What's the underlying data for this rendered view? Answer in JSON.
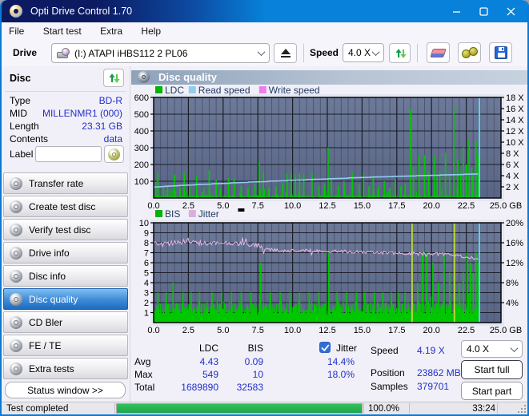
{
  "window": {
    "title": "Opti Drive Control 1.70"
  },
  "menu": {
    "items": [
      "File",
      "Start test",
      "Extra",
      "Help"
    ]
  },
  "toolbar": {
    "drive_label": "Drive",
    "drive_value": "(I:)   ATAPI iHBS112   2 PL06",
    "speed_label": "Speed",
    "speed_value": "4.0 X"
  },
  "sidebar": {
    "disc_header": "Disc",
    "info": [
      {
        "label": "Type",
        "value": "BD-R"
      },
      {
        "label": "MID",
        "value": "MILLENMR1 (000)"
      },
      {
        "label": "Length",
        "value": "23.31 GB"
      },
      {
        "label": "Contents",
        "value": "data"
      }
    ],
    "label_field": {
      "label": "Label",
      "value": ""
    },
    "buttons": [
      {
        "label": "Transfer rate",
        "selected": false
      },
      {
        "label": "Create test disc",
        "selected": false
      },
      {
        "label": "Verify test disc",
        "selected": false
      },
      {
        "label": "Drive info",
        "selected": false
      },
      {
        "label": "Disc info",
        "selected": false
      },
      {
        "label": "Disc quality",
        "selected": true
      },
      {
        "label": "CD Bler",
        "selected": false
      },
      {
        "label": "FE / TE",
        "selected": false
      },
      {
        "label": "Extra tests",
        "selected": false
      }
    ],
    "status_window_button": "Status window >>"
  },
  "main": {
    "header": "Disc quality"
  },
  "stats": {
    "col_ldc": "LDC",
    "col_bis": "BIS",
    "jitter_label": "Jitter",
    "jitter_checked": true,
    "rows": [
      {
        "label": "Avg",
        "ldc": "4.43",
        "bis": "0.09",
        "jitter": "14.4%"
      },
      {
        "label": "Max",
        "ldc": "549",
        "bis": "10",
        "jitter": "18.0%"
      },
      {
        "label": "Total",
        "ldc": "1689890",
        "bis": "32583",
        "jitter": ""
      }
    ],
    "speed_label": "Speed",
    "speed_value": "4.19 X",
    "position_label": "Position",
    "position_value": "23862 MB",
    "samples_label": "Samples",
    "samples_value": "379701",
    "speed_select": "4.0 X",
    "start_full": "Start full",
    "start_part": "Start part"
  },
  "statusbar": {
    "status": "Test completed",
    "percent": "100.0%",
    "percent_value": 100,
    "elapsed": "33:24"
  },
  "colors": {
    "titlebar_navy": "#0c1a61",
    "titlebar_azure": "#0781d9",
    "value_blue": "#2230c8",
    "plot_bg": "#616e8e",
    "ldc_green": "#00c800",
    "read_speed_blue": "#93cbf1",
    "write_speed_pink": "#ef7cf0",
    "jitter_pink": "#e3b9e6",
    "end_marker_cyan": "#59d3f7",
    "progress_green": "#22ac4d"
  },
  "chart_data": [
    {
      "type": "area",
      "title": "LDC / Read speed / Write speed vs position",
      "legend": [
        {
          "label": "LDC",
          "color": "#00b400"
        },
        {
          "label": "Read speed",
          "color": "#93cbf1"
        },
        {
          "label": "Write speed",
          "color": "#ef7cf0"
        }
      ],
      "legend_marker": false,
      "xlim": [
        0,
        25
      ],
      "x_ticks": [
        0.0,
        2.5,
        5.0,
        7.5,
        10.0,
        12.5,
        15.0,
        17.5,
        20.0,
        22.5,
        25.0
      ],
      "x_unit": "GB",
      "x_minor_step": 0.5,
      "left_axis": {
        "lim": [
          0,
          600
        ],
        "ticks": [
          100,
          200,
          300,
          400,
          500,
          600
        ],
        "suffix": ""
      },
      "right_axis": {
        "lim": [
          0,
          18
        ],
        "ticks": [
          2,
          4,
          6,
          8,
          10,
          12,
          14,
          16,
          18
        ],
        "suffix": " X"
      },
      "data_end_x": 23.42,
      "texture_seed": 11,
      "series": [
        {
          "name": "LDC",
          "kind": "spikes",
          "axis": "left",
          "color": "#00c800",
          "baseline": {
            "min": 3,
            "max": 18,
            "burst_chance": 0.09,
            "burst_extra": 50
          },
          "points": [
            [
              0.15,
              95
            ],
            [
              0.3,
              150
            ],
            [
              0.7,
              60
            ],
            [
              1.0,
              70
            ],
            [
              1.5,
              140
            ],
            [
              1.9,
              60
            ],
            [
              2.2,
              150
            ],
            [
              2.6,
              70
            ],
            [
              3.1,
              130
            ],
            [
              3.6,
              60
            ],
            [
              4.0,
              165
            ],
            [
              4.5,
              110
            ],
            [
              4.8,
              55
            ],
            [
              5.4,
              120
            ],
            [
              5.8,
              115
            ],
            [
              6.3,
              70
            ],
            [
              6.8,
              60
            ],
            [
              7.3,
              80
            ],
            [
              7.6,
              215
            ],
            [
              7.9,
              160
            ],
            [
              8.3,
              60
            ],
            [
              8.8,
              70
            ],
            [
              9.3,
              90
            ],
            [
              9.6,
              145
            ],
            [
              9.9,
              150
            ],
            [
              10.2,
              140
            ],
            [
              10.5,
              150
            ],
            [
              10.8,
              140
            ],
            [
              11.4,
              150
            ],
            [
              11.9,
              70
            ],
            [
              12.3,
              80
            ],
            [
              12.55,
              300
            ],
            [
              12.8,
              120
            ],
            [
              13.3,
              70
            ],
            [
              13.7,
              100
            ],
            [
              14.3,
              150
            ],
            [
              14.8,
              80
            ],
            [
              15.1,
              150
            ],
            [
              15.5,
              70
            ],
            [
              15.8,
              130
            ],
            [
              16.2,
              70
            ],
            [
              16.6,
              100
            ],
            [
              17.0,
              60
            ],
            [
              17.4,
              110
            ],
            [
              17.8,
              70
            ],
            [
              18.1,
              90
            ],
            [
              18.5,
              530
            ],
            [
              18.7,
              180
            ],
            [
              19.1,
              260
            ],
            [
              19.5,
              255
            ],
            [
              19.8,
              150
            ],
            [
              20.2,
              250
            ],
            [
              20.4,
              120
            ],
            [
              20.6,
              160
            ],
            [
              21.0,
              270
            ],
            [
              21.3,
              150
            ],
            [
              21.6,
              545
            ],
            [
              21.9,
              230
            ],
            [
              22.1,
              160
            ],
            [
              22.3,
              300
            ],
            [
              22.5,
              200
            ],
            [
              22.7,
              350
            ],
            [
              22.9,
              180
            ],
            [
              23.0,
              150
            ],
            [
              23.2,
              340
            ],
            [
              23.35,
              250
            ]
          ]
        },
        {
          "name": "Read speed",
          "kind": "line",
          "axis": "right",
          "color": "#93cbf1",
          "points": [
            [
              0,
              1.95
            ],
            [
              0.8,
              2.05
            ],
            [
              0.81,
              2.1
            ],
            [
              1.8,
              2.2
            ],
            [
              1.81,
              2.25
            ],
            [
              3.0,
              2.35
            ],
            [
              3.01,
              2.4
            ],
            [
              4.2,
              2.5
            ],
            [
              4.21,
              2.55
            ],
            [
              5.5,
              2.65
            ],
            [
              5.51,
              2.7
            ],
            [
              6.8,
              2.8
            ],
            [
              6.81,
              2.85
            ],
            [
              8.2,
              2.95
            ],
            [
              8.21,
              3.0
            ],
            [
              9.6,
              3.1
            ],
            [
              9.61,
              3.15
            ],
            [
              11.0,
              3.25
            ],
            [
              11.01,
              3.3
            ],
            [
              12.5,
              3.4
            ],
            [
              12.51,
              3.45
            ],
            [
              14.0,
              3.55
            ],
            [
              14.01,
              3.6
            ],
            [
              15.6,
              3.7
            ],
            [
              15.61,
              3.74
            ],
            [
              17.2,
              3.83
            ],
            [
              17.21,
              3.87
            ],
            [
              18.9,
              3.95
            ],
            [
              18.91,
              4.0
            ],
            [
              20.6,
              4.08
            ],
            [
              20.61,
              4.12
            ],
            [
              22.3,
              4.2
            ],
            [
              22.31,
              4.24
            ],
            [
              23.35,
              4.3
            ]
          ]
        },
        {
          "name": "Write speed",
          "kind": "line",
          "axis": "right",
          "color": "#ef7cf0",
          "points": []
        }
      ],
      "end_marker": {
        "x": 23.45,
        "color": "#59d3f7"
      }
    },
    {
      "type": "area",
      "title": "BIS / Jitter vs position",
      "legend": [
        {
          "label": "BIS",
          "color": "#00b400"
        },
        {
          "label": "Jitter",
          "color": "#dcaede"
        }
      ],
      "legend_marker": true,
      "xlim": [
        0,
        25
      ],
      "x_ticks": [
        0.0,
        2.5,
        5.0,
        7.5,
        10.0,
        12.5,
        15.0,
        17.5,
        20.0,
        22.5,
        25.0
      ],
      "x_unit": "GB",
      "x_minor_step": 0.5,
      "left_axis": {
        "lim": [
          0,
          10
        ],
        "ticks": [
          1,
          2,
          3,
          4,
          5,
          6,
          7,
          8,
          9,
          10
        ],
        "suffix": ""
      },
      "right_axis": {
        "lim": [
          0,
          20
        ],
        "ticks": [
          4,
          8,
          12,
          16,
          20
        ],
        "suffix": "%"
      },
      "data_end_x": 23.42,
      "texture_seed": 29,
      "series": [
        {
          "name": "BIS",
          "kind": "spikes",
          "axis": "left",
          "color": "#00c800",
          "highlight_color": "#b6d53a",
          "baseline": {
            "min": 0.7,
            "max": 2.1,
            "burst_chance": 0.1,
            "burst_extra": 0.9,
            "solid_fill_to": 0.8
          },
          "points": [
            [
              0.3,
              3
            ],
            [
              0.9,
              3
            ],
            [
              1.4,
              4
            ],
            [
              2.1,
              3
            ],
            [
              2.7,
              3
            ],
            [
              3.3,
              3
            ],
            [
              4.2,
              3
            ],
            [
              4.9,
              3
            ],
            [
              5.6,
              3
            ],
            [
              6.3,
              3
            ],
            [
              7.0,
              3
            ],
            [
              7.7,
              6
            ],
            [
              8.4,
              3
            ],
            [
              9.1,
              3
            ],
            [
              9.8,
              3
            ],
            [
              10.5,
              3
            ],
            [
              11.2,
              3
            ],
            [
              11.9,
              3
            ],
            [
              12.6,
              7
            ],
            [
              13.2,
              3
            ],
            [
              13.9,
              3
            ],
            [
              14.6,
              3
            ],
            [
              15.2,
              3
            ],
            [
              15.9,
              3
            ],
            [
              16.5,
              3
            ],
            [
              17.1,
              3
            ],
            [
              17.6,
              3
            ],
            [
              18.1,
              3
            ],
            [
              18.6,
              10,
              "hl"
            ],
            [
              19.0,
              4
            ],
            [
              19.35,
              7
            ],
            [
              19.65,
              7
            ],
            [
              20.1,
              6
            ],
            [
              20.5,
              4
            ],
            [
              20.9,
              7
            ],
            [
              21.3,
              5
            ],
            [
              21.65,
              10,
              "hl"
            ],
            [
              22.0,
              4
            ],
            [
              22.3,
              5
            ],
            [
              22.55,
              7
            ],
            [
              22.8,
              6
            ],
            [
              23.0,
              5
            ],
            [
              23.2,
              7
            ],
            [
              23.35,
              6
            ]
          ]
        },
        {
          "name": "Jitter",
          "kind": "noisy-line",
          "axis": "right",
          "color": "#e3b9e6",
          "trend": [
            [
              0,
              15.8
            ],
            [
              1,
              15.9
            ],
            [
              2,
              16.0
            ],
            [
              2.4,
              16.6
            ],
            [
              3,
              15.9
            ],
            [
              4,
              15.9
            ],
            [
              5,
              15.8
            ],
            [
              6,
              15.8
            ],
            [
              7,
              15.6
            ],
            [
              7.6,
              15.4
            ],
            [
              7.9,
              14.7
            ],
            [
              9,
              14.5
            ],
            [
              10,
              14.4
            ],
            [
              11,
              14.4
            ],
            [
              12,
              14.3
            ],
            [
              13,
              14.3
            ],
            [
              14,
              14.2
            ],
            [
              15,
              14.1
            ],
            [
              16,
              14.0
            ],
            [
              17,
              14.0
            ],
            [
              18,
              13.9
            ],
            [
              19,
              13.8
            ],
            [
              20,
              13.7
            ],
            [
              21,
              13.8
            ],
            [
              22,
              13.4
            ],
            [
              22.8,
              13.0
            ],
            [
              23.2,
              12.7
            ],
            [
              23.4,
              12.5
            ]
          ],
          "noise_amp_early": 0.5,
          "noise_amp_late": 0.33,
          "noise_split_x": 7.6
        }
      ],
      "end_marker": {
        "x": 23.45,
        "color": "#59d3f7"
      }
    }
  ]
}
